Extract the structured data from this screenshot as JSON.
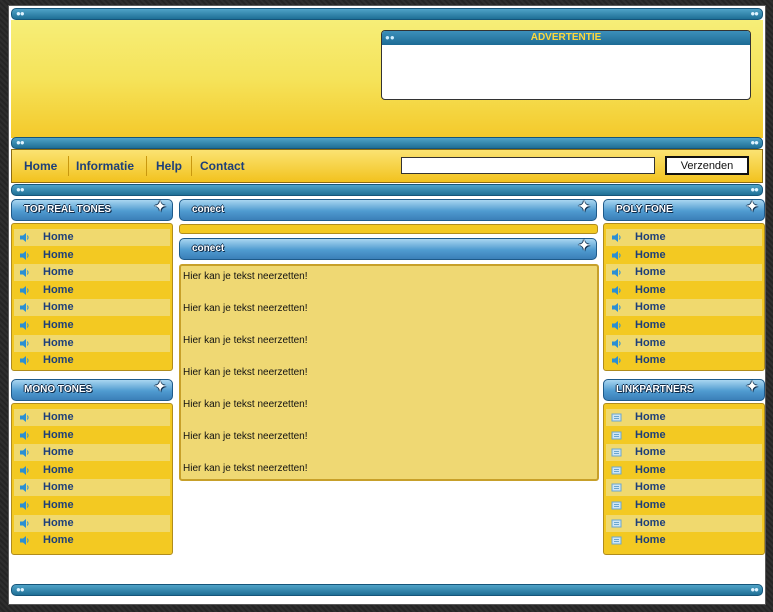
{
  "advertisement": {
    "title": "ADVERTENTIE"
  },
  "nav": {
    "links": [
      "Home",
      "Informatie",
      "Help",
      "Contact"
    ],
    "search": {
      "value": "",
      "placeholder": ""
    },
    "submit_label": "Verzenden"
  },
  "left": {
    "top_real_tones": {
      "title": "TOP REAL TONES",
      "items": [
        "Home",
        "Home",
        "Home",
        "Home",
        "Home",
        "Home",
        "Home",
        "Home"
      ]
    },
    "mono_tones": {
      "title": "MONO TONES",
      "items": [
        "Home",
        "Home",
        "Home",
        "Home",
        "Home",
        "Home",
        "Home",
        "Home"
      ]
    }
  },
  "center": {
    "header1": "conect",
    "header2": "conect",
    "lines": [
      "Hier kan je tekst neerzetten!",
      "Hier kan je tekst neerzetten!",
      "Hier kan je tekst neerzetten!",
      "Hier kan je tekst neerzetten!",
      "Hier kan je tekst neerzetten!",
      "Hier kan je tekst neerzetten!",
      "Hier kan je tekst neerzetten!"
    ]
  },
  "right": {
    "poly_fone": {
      "title": "POLY FONE",
      "items": [
        "Home",
        "Home",
        "Home",
        "Home",
        "Home",
        "Home",
        "Home",
        "Home"
      ]
    },
    "linkpartners": {
      "title": "LINKPARTNERS",
      "items": [
        "Home",
        "Home",
        "Home",
        "Home",
        "Home",
        "Home",
        "Home",
        "Home"
      ]
    }
  },
  "colors": {
    "link": "#1d3f7a",
    "panel": "#f3c922",
    "panel_alt": "#f0d96e",
    "header_blue": "#3b7fb8",
    "ad_title": "#ffd83a"
  },
  "icons": {
    "tone_list": "speaker-icon",
    "link_list": "page-icon"
  }
}
